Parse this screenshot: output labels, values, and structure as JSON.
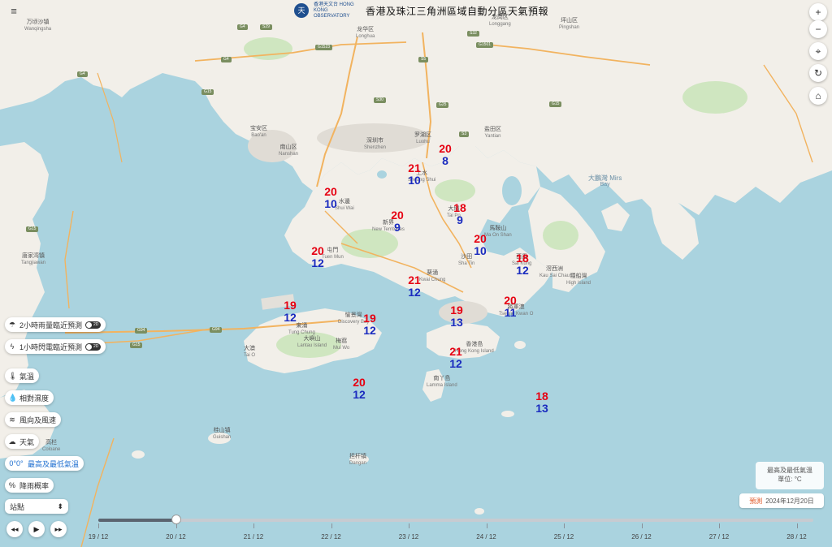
{
  "header": {
    "logo_glyph": "天",
    "org_name": "香港天文台 HONG KONG OBSERVATORY",
    "title": "香港及珠江三角洲區域自動分區天氣預報"
  },
  "menu_icon": "≡",
  "controls": {
    "zoom_in": "+",
    "zoom_out": "−",
    "locate": "⌖",
    "refresh": "↻",
    "home": "⌂"
  },
  "places": [
    {
      "zh": "万顷沙镇",
      "en": "Wanqingsha"
    },
    {
      "zh": "龙华区",
      "en": "Longhua"
    },
    {
      "zh": "龙岗区",
      "en": "Longgang"
    },
    {
      "zh": "坪山区",
      "en": "Pingshan"
    },
    {
      "zh": "宝安区",
      "en": "Bao'an"
    },
    {
      "zh": "南山区",
      "en": "Nanshan"
    },
    {
      "zh": "深圳市",
      "en": "Shenzhen"
    },
    {
      "zh": "罗湖区",
      "en": "Luohu"
    },
    {
      "zh": "盐田区",
      "en": "Yantian"
    },
    {
      "zh": "大鵬灣 Mirs",
      "en": "Bay"
    },
    {
      "zh": "唐家湾镇",
      "en": "Tangjiawan"
    },
    {
      "zh": "水邊",
      "en": "Shui Wai"
    },
    {
      "zh": "新界",
      "en": "New Territories"
    },
    {
      "zh": "屯門",
      "en": "Tuen Mun"
    },
    {
      "zh": "大嶼山",
      "en": "Lantau Island"
    },
    {
      "zh": "東涌",
      "en": "Tung Chung"
    },
    {
      "zh": "梅窩",
      "en": "Mui Wo"
    },
    {
      "zh": "愉景灣",
      "en": "Discovery Bay"
    },
    {
      "zh": "大澳",
      "en": "Tai O"
    },
    {
      "zh": "香港島",
      "en": "Hong Kong Island"
    },
    {
      "zh": "南丫島",
      "en": "Lamma Island"
    },
    {
      "zh": "西貢",
      "en": "Sai Kung"
    },
    {
      "zh": "滘西洲",
      "en": "Kau Sai Chau"
    },
    {
      "zh": "糧船灣",
      "en": "High Island"
    },
    {
      "zh": "桂山镇",
      "en": "Guishan"
    },
    {
      "zh": "担杆镇",
      "en": "Dangan"
    },
    {
      "zh": "高栏",
      "en": "Coloane"
    },
    {
      "zh": "大埔",
      "en": "Tai Po"
    },
    {
      "zh": "沙田",
      "en": "Sha Tin"
    },
    {
      "zh": "葵涌",
      "en": "Kwai Chung"
    },
    {
      "zh": "馬鞍山",
      "en": "Ma On Shan"
    },
    {
      "zh": "上水",
      "en": "Sheung Shui"
    },
    {
      "zh": "將軍澳",
      "en": "Tseung Kwan O"
    }
  ],
  "roads": [
    "G4",
    "G15",
    "G94",
    "G15",
    "G1523",
    "G94",
    "S3",
    "S32",
    "S5",
    "G4",
    "G1501",
    "G25",
    "S29",
    "G4",
    "G15",
    "S30",
    "G15"
  ],
  "temperatures": [
    {
      "max": "20",
      "min": "8"
    },
    {
      "max": "21",
      "min": "10"
    },
    {
      "max": "20",
      "min": "10"
    },
    {
      "max": "18",
      "min": "9"
    },
    {
      "max": "20",
      "min": "9"
    },
    {
      "max": "20",
      "min": "10"
    },
    {
      "max": "20",
      "min": "12"
    },
    {
      "max": "18",
      "min": "12"
    },
    {
      "max": "21",
      "min": "12"
    },
    {
      "max": "19",
      "min": "12"
    },
    {
      "max": "19",
      "min": "12"
    },
    {
      "max": "19",
      "min": "13"
    },
    {
      "max": "20",
      "min": "11"
    },
    {
      "max": "21",
      "min": "12"
    },
    {
      "max": "20",
      "min": "12"
    },
    {
      "max": "18",
      "min": "13"
    }
  ],
  "layers": [
    {
      "label": "2小時雨量臨近預測",
      "icon": "☂",
      "toggle": "2D"
    },
    {
      "label": "1小時閃電臨近預測",
      "icon": "ϟ",
      "toggle": "2D"
    },
    {
      "label": "氣溫",
      "icon": "🌡"
    },
    {
      "label": "相對濕度",
      "icon": "💧"
    },
    {
      "label": "風向及風速",
      "icon": "≋"
    },
    {
      "label": "天氣",
      "icon": "☁"
    },
    {
      "label": "最高及最低氣溫",
      "icon": "0°0°"
    },
    {
      "label": "降雨概率",
      "icon": "%"
    }
  ],
  "station_select": {
    "label": "站點",
    "arrow": "⬍"
  },
  "playback": {
    "rewind": "◂◂",
    "play": "▶",
    "forward": "▸▸"
  },
  "legend": {
    "line1": "最高及最低氣溫",
    "line2": "單位: °C"
  },
  "forecast": {
    "tag": "預測",
    "date": "2024年12月20日"
  },
  "timeline": {
    "labels": [
      "19 / 12",
      "20 / 12",
      "21 / 12",
      "22 / 12",
      "23 / 12",
      "24 / 12",
      "25 / 12",
      "26 / 12",
      "27 / 12",
      "28 / 12"
    ],
    "selected_index": 1
  },
  "colors": {
    "max_temp": "#e60012",
    "min_temp": "#1a2bbf",
    "sea": "#aad3df",
    "land": "#f2efe9"
  }
}
